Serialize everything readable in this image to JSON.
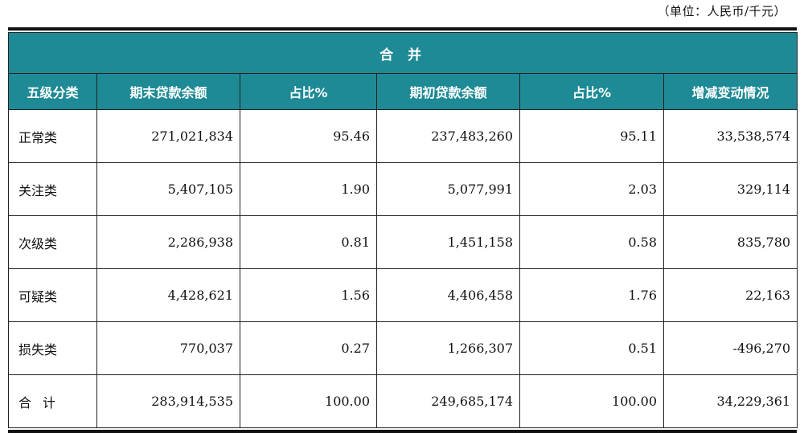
{
  "unit_label": "（单位：人民币/千元）",
  "table": {
    "group_header": "合 并",
    "columns": [
      "五级分类",
      "期末贷款余额",
      "占比%",
      "期初贷款余额",
      "占比%",
      "增减变动情况"
    ],
    "rows": [
      {
        "category": "正常类",
        "end_balance": "271,021,834",
        "end_pct": "95.46",
        "begin_balance": "237,483,260",
        "begin_pct": "95.11",
        "change": "33,538,574"
      },
      {
        "category": "关注类",
        "end_balance": "5,407,105",
        "end_pct": "1.90",
        "begin_balance": "5,077,991",
        "begin_pct": "2.03",
        "change": "329,114"
      },
      {
        "category": "次级类",
        "end_balance": "2,286,938",
        "end_pct": "0.81",
        "begin_balance": "1,451,158",
        "begin_pct": "0.58",
        "change": "835,780"
      },
      {
        "category": "可疑类",
        "end_balance": "4,428,621",
        "end_pct": "1.56",
        "begin_balance": "4,406,458",
        "begin_pct": "1.76",
        "change": "22,163"
      },
      {
        "category": "损失类",
        "end_balance": "770,037",
        "end_pct": "0.27",
        "begin_balance": "1,266,307",
        "begin_pct": "0.51",
        "change": "-496,270"
      },
      {
        "category": "合计",
        "end_balance": "283,914,535",
        "end_pct": "100.00",
        "begin_balance": "249,685,174",
        "begin_pct": "100.00",
        "change": "34,229,361"
      }
    ]
  },
  "colors": {
    "header_bg": "#1e8a95",
    "header_text": "#ffffff"
  }
}
